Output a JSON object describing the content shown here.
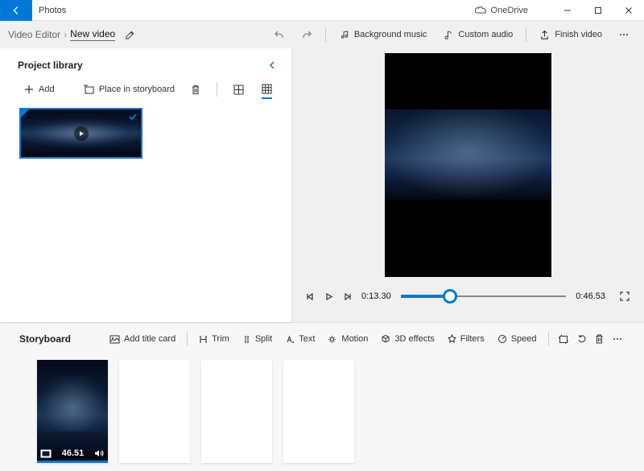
{
  "titlebar": {
    "app_name": "Photos",
    "onedrive_label": "OneDrive"
  },
  "subheader": {
    "breadcrumb_root": "Video Editor",
    "video_name": "New video",
    "bg_music": "Background music",
    "custom_audio": "Custom audio",
    "finish": "Finish video"
  },
  "library": {
    "title": "Project library",
    "add_label": "Add",
    "place_label": "Place in storyboard"
  },
  "preview": {
    "current_time": "0:13.30",
    "total_time": "0:46.53"
  },
  "storyboard": {
    "title": "Storyboard",
    "add_title": "Add title card",
    "trim": "Trim",
    "split": "Split",
    "text": "Text",
    "motion": "Motion",
    "effects": "3D effects",
    "filters": "Filters",
    "speed": "Speed",
    "clip_duration": "46.51"
  }
}
